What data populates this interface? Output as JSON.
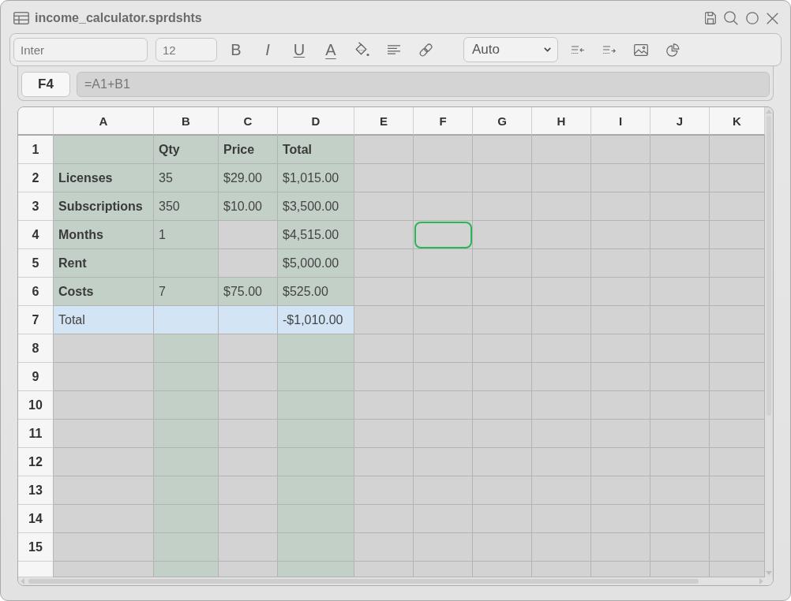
{
  "window": {
    "title": "income_calculator.sprdshts"
  },
  "toolbar": {
    "font": "Inter",
    "font_size": "12",
    "format_buttons": [
      {
        "kind": "bold",
        "label": "B"
      },
      {
        "kind": "italic",
        "label": "I"
      },
      {
        "kind": "underline",
        "label": "U"
      },
      {
        "kind": "text_color",
        "label": "A"
      }
    ],
    "number_format": "Auto"
  },
  "formula_bar": {
    "cell_reference": "F4",
    "formula": "=A1+B1"
  },
  "sheet": {
    "columns": [
      "A",
      "B",
      "C",
      "D",
      "E",
      "F",
      "G",
      "H",
      "I",
      "J",
      "K"
    ],
    "rows": [
      {
        "number": "1",
        "cells": [
          {
            "shaded": true,
            "highlighted": false,
            "selected": false
          },
          {
            "value": "Qty",
            "bold": true,
            "shaded": true,
            "highlighted": false,
            "selected": false
          },
          {
            "value": "Price",
            "bold": true,
            "shaded": true,
            "highlighted": false,
            "selected": false
          },
          {
            "value": "Total",
            "bold": true,
            "shaded": true,
            "highlighted": false,
            "selected": false
          },
          {
            "shaded": false,
            "highlighted": false,
            "selected": false
          },
          {
            "shaded": false,
            "highlighted": false,
            "selected": false
          },
          {
            "shaded": false,
            "highlighted": false,
            "selected": false
          },
          {
            "shaded": false,
            "highlighted": false,
            "selected": false
          },
          {
            "shaded": false,
            "highlighted": false,
            "selected": false
          },
          {
            "shaded": false,
            "highlighted": false,
            "selected": false
          },
          {
            "shaded": false,
            "highlighted": false,
            "selected": false
          }
        ]
      },
      {
        "number": "2",
        "cells": [
          {
            "value": "Licenses",
            "bold": true,
            "shaded": true,
            "highlighted": false,
            "selected": false
          },
          {
            "value": "35",
            "bold": false,
            "shaded": true,
            "highlighted": false,
            "selected": false
          },
          {
            "value": "$29.00",
            "bold": false,
            "shaded": true,
            "highlighted": false,
            "selected": false
          },
          {
            "value": "$1,015.00",
            "bold": false,
            "shaded": true,
            "highlighted": false,
            "selected": false
          },
          {
            "shaded": false,
            "highlighted": false,
            "selected": false
          },
          {
            "shaded": false,
            "highlighted": false,
            "selected": false
          },
          {
            "shaded": false,
            "highlighted": false,
            "selected": false
          },
          {
            "shaded": false,
            "highlighted": false,
            "selected": false
          },
          {
            "shaded": false,
            "highlighted": false,
            "selected": false
          },
          {
            "shaded": false,
            "highlighted": false,
            "selected": false
          },
          {
            "shaded": false,
            "highlighted": false,
            "selected": false
          }
        ]
      },
      {
        "number": "3",
        "cells": [
          {
            "value": "Subscriptions",
            "bold": true,
            "shaded": true,
            "highlighted": false,
            "selected": false
          },
          {
            "value": "350",
            "bold": false,
            "shaded": true,
            "highlighted": false,
            "selected": false
          },
          {
            "value": "$10.00",
            "bold": false,
            "shaded": true,
            "highlighted": false,
            "selected": false
          },
          {
            "value": "$3,500.00",
            "bold": false,
            "shaded": true,
            "highlighted": false,
            "selected": false
          },
          {
            "shaded": false,
            "highlighted": false,
            "selected": false
          },
          {
            "shaded": false,
            "highlighted": false,
            "selected": false
          },
          {
            "shaded": false,
            "highlighted": false,
            "selected": false
          },
          {
            "shaded": false,
            "highlighted": false,
            "selected": false
          },
          {
            "shaded": false,
            "highlighted": false,
            "selected": false
          },
          {
            "shaded": false,
            "highlighted": false,
            "selected": false
          },
          {
            "shaded": false,
            "highlighted": false,
            "selected": false
          }
        ]
      },
      {
        "number": "4",
        "cells": [
          {
            "value": "Months",
            "bold": true,
            "shaded": true,
            "highlighted": false,
            "selected": false
          },
          {
            "value": "1",
            "bold": false,
            "shaded": true,
            "highlighted": false,
            "selected": false
          },
          {
            "shaded": false,
            "highlighted": false,
            "selected": false
          },
          {
            "value": "$4,515.00",
            "bold": false,
            "shaded": true,
            "highlighted": false,
            "selected": false
          },
          {
            "shaded": false,
            "highlighted": false,
            "selected": false
          },
          {
            "shaded": false,
            "highlighted": false,
            "selected": true
          },
          {
            "shaded": false,
            "highlighted": false,
            "selected": false
          },
          {
            "shaded": false,
            "highlighted": false,
            "selected": false
          },
          {
            "shaded": false,
            "highlighted": false,
            "selected": false
          },
          {
            "shaded": false,
            "highlighted": false,
            "selected": false
          },
          {
            "shaded": false,
            "highlighted": false,
            "selected": false
          }
        ]
      },
      {
        "number": "5",
        "cells": [
          {
            "value": "Rent",
            "bold": true,
            "shaded": true,
            "highlighted": false,
            "selected": false
          },
          {
            "shaded": true,
            "highlighted": false,
            "selected": false
          },
          {
            "shaded": false,
            "highlighted": false,
            "selected": false
          },
          {
            "value": "$5,000.00",
            "bold": false,
            "shaded": true,
            "highlighted": false,
            "selected": false
          },
          {
            "shaded": false,
            "highlighted": false,
            "selected": false
          },
          {
            "shaded": false,
            "highlighted": false,
            "selected": false
          },
          {
            "shaded": false,
            "highlighted": false,
            "selected": false
          },
          {
            "shaded": false,
            "highlighted": false,
            "selected": false
          },
          {
            "shaded": false,
            "highlighted": false,
            "selected": false
          },
          {
            "shaded": false,
            "highlighted": false,
            "selected": false
          },
          {
            "shaded": false,
            "highlighted": false,
            "selected": false
          }
        ]
      },
      {
        "number": "6",
        "cells": [
          {
            "value": "Costs",
            "bold": true,
            "shaded": true,
            "highlighted": false,
            "selected": false
          },
          {
            "value": "7",
            "bold": false,
            "shaded": true,
            "highlighted": false,
            "selected": false
          },
          {
            "value": "$75.00",
            "bold": false,
            "shaded": true,
            "highlighted": false,
            "selected": false
          },
          {
            "value": "$525.00",
            "bold": false,
            "shaded": true,
            "highlighted": false,
            "selected": false
          },
          {
            "shaded": false,
            "highlighted": false,
            "selected": false
          },
          {
            "shaded": false,
            "highlighted": false,
            "selected": false
          },
          {
            "shaded": false,
            "highlighted": false,
            "selected": false
          },
          {
            "shaded": false,
            "highlighted": false,
            "selected": false
          },
          {
            "shaded": false,
            "highlighted": false,
            "selected": false
          },
          {
            "shaded": false,
            "highlighted": false,
            "selected": false
          },
          {
            "shaded": false,
            "highlighted": false,
            "selected": false
          }
        ]
      },
      {
        "number": "7",
        "cells": [
          {
            "value": "Total",
            "bold": false,
            "shaded": false,
            "highlighted": true,
            "selected": false
          },
          {
            "shaded": false,
            "highlighted": true,
            "selected": false
          },
          {
            "shaded": false,
            "highlighted": true,
            "selected": false
          },
          {
            "value": "-$1,010.00",
            "bold": false,
            "shaded": false,
            "highlighted": true,
            "selected": false
          },
          {
            "shaded": false,
            "highlighted": false,
            "selected": false
          },
          {
            "shaded": false,
            "highlighted": false,
            "selected": false
          },
          {
            "shaded": false,
            "highlighted": false,
            "selected": false
          },
          {
            "shaded": false,
            "highlighted": false,
            "selected": false
          },
          {
            "shaded": false,
            "highlighted": false,
            "selected": false
          },
          {
            "shaded": false,
            "highlighted": false,
            "selected": false
          },
          {
            "shaded": false,
            "highlighted": false,
            "selected": false
          }
        ]
      },
      {
        "number": "8",
        "cells": [
          {
            "shaded": false,
            "highlighted": false,
            "selected": false
          },
          {
            "shaded": true,
            "highlighted": false,
            "selected": false
          },
          {
            "shaded": false,
            "highlighted": false,
            "selected": false
          },
          {
            "shaded": true,
            "highlighted": false,
            "selected": false
          },
          {
            "shaded": false,
            "highlighted": false,
            "selected": false
          },
          {
            "shaded": false,
            "highlighted": false,
            "selected": false
          },
          {
            "shaded": false,
            "highlighted": false,
            "selected": false
          },
          {
            "shaded": false,
            "highlighted": false,
            "selected": false
          },
          {
            "shaded": false,
            "highlighted": false,
            "selected": false
          },
          {
            "shaded": false,
            "highlighted": false,
            "selected": false
          },
          {
            "shaded": false,
            "highlighted": false,
            "selected": false
          }
        ]
      },
      {
        "number": "9",
        "cells": [
          {
            "shaded": false,
            "highlighted": false,
            "selected": false
          },
          {
            "shaded": true,
            "highlighted": false,
            "selected": false
          },
          {
            "shaded": false,
            "highlighted": false,
            "selected": false
          },
          {
            "shaded": true,
            "highlighted": false,
            "selected": false
          },
          {
            "shaded": false,
            "highlighted": false,
            "selected": false
          },
          {
            "shaded": false,
            "highlighted": false,
            "selected": false
          },
          {
            "shaded": false,
            "highlighted": false,
            "selected": false
          },
          {
            "shaded": false,
            "highlighted": false,
            "selected": false
          },
          {
            "shaded": false,
            "highlighted": false,
            "selected": false
          },
          {
            "shaded": false,
            "highlighted": false,
            "selected": false
          },
          {
            "shaded": false,
            "highlighted": false,
            "selected": false
          }
        ]
      },
      {
        "number": "10",
        "cells": [
          {
            "shaded": false,
            "highlighted": false,
            "selected": false
          },
          {
            "shaded": true,
            "highlighted": false,
            "selected": false
          },
          {
            "shaded": false,
            "highlighted": false,
            "selected": false
          },
          {
            "shaded": true,
            "highlighted": false,
            "selected": false
          },
          {
            "shaded": false,
            "highlighted": false,
            "selected": false
          },
          {
            "shaded": false,
            "highlighted": false,
            "selected": false
          },
          {
            "shaded": false,
            "highlighted": false,
            "selected": false
          },
          {
            "shaded": false,
            "highlighted": false,
            "selected": false
          },
          {
            "shaded": false,
            "highlighted": false,
            "selected": false
          },
          {
            "shaded": false,
            "highlighted": false,
            "selected": false
          },
          {
            "shaded": false,
            "highlighted": false,
            "selected": false
          }
        ]
      },
      {
        "number": "11",
        "cells": [
          {
            "shaded": false,
            "highlighted": false,
            "selected": false
          },
          {
            "shaded": true,
            "highlighted": false,
            "selected": false
          },
          {
            "shaded": false,
            "highlighted": false,
            "selected": false
          },
          {
            "shaded": true,
            "highlighted": false,
            "selected": false
          },
          {
            "shaded": false,
            "highlighted": false,
            "selected": false
          },
          {
            "shaded": false,
            "highlighted": false,
            "selected": false
          },
          {
            "shaded": false,
            "highlighted": false,
            "selected": false
          },
          {
            "shaded": false,
            "highlighted": false,
            "selected": false
          },
          {
            "shaded": false,
            "highlighted": false,
            "selected": false
          },
          {
            "shaded": false,
            "highlighted": false,
            "selected": false
          },
          {
            "shaded": false,
            "highlighted": false,
            "selected": false
          }
        ]
      },
      {
        "number": "12",
        "cells": [
          {
            "shaded": false,
            "highlighted": false,
            "selected": false
          },
          {
            "shaded": true,
            "highlighted": false,
            "selected": false
          },
          {
            "shaded": false,
            "highlighted": false,
            "selected": false
          },
          {
            "shaded": true,
            "highlighted": false,
            "selected": false
          },
          {
            "shaded": false,
            "highlighted": false,
            "selected": false
          },
          {
            "shaded": false,
            "highlighted": false,
            "selected": false
          },
          {
            "shaded": false,
            "highlighted": false,
            "selected": false
          },
          {
            "shaded": false,
            "highlighted": false,
            "selected": false
          },
          {
            "shaded": false,
            "highlighted": false,
            "selected": false
          },
          {
            "shaded": false,
            "highlighted": false,
            "selected": false
          },
          {
            "shaded": false,
            "highlighted": false,
            "selected": false
          }
        ]
      },
      {
        "number": "13",
        "cells": [
          {
            "shaded": false,
            "highlighted": false,
            "selected": false
          },
          {
            "shaded": true,
            "highlighted": false,
            "selected": false
          },
          {
            "shaded": false,
            "highlighted": false,
            "selected": false
          },
          {
            "shaded": true,
            "highlighted": false,
            "selected": false
          },
          {
            "shaded": false,
            "highlighted": false,
            "selected": false
          },
          {
            "shaded": false,
            "highlighted": false,
            "selected": false
          },
          {
            "shaded": false,
            "highlighted": false,
            "selected": false
          },
          {
            "shaded": false,
            "highlighted": false,
            "selected": false
          },
          {
            "shaded": false,
            "highlighted": false,
            "selected": false
          },
          {
            "shaded": false,
            "highlighted": false,
            "selected": false
          },
          {
            "shaded": false,
            "highlighted": false,
            "selected": false
          }
        ]
      },
      {
        "number": "14",
        "cells": [
          {
            "shaded": false,
            "highlighted": false,
            "selected": false
          },
          {
            "shaded": true,
            "highlighted": false,
            "selected": false
          },
          {
            "shaded": false,
            "highlighted": false,
            "selected": false
          },
          {
            "shaded": true,
            "highlighted": false,
            "selected": false
          },
          {
            "shaded": false,
            "highlighted": false,
            "selected": false
          },
          {
            "shaded": false,
            "highlighted": false,
            "selected": false
          },
          {
            "shaded": false,
            "highlighted": false,
            "selected": false
          },
          {
            "shaded": false,
            "highlighted": false,
            "selected": false
          },
          {
            "shaded": false,
            "highlighted": false,
            "selected": false
          },
          {
            "shaded": false,
            "highlighted": false,
            "selected": false
          },
          {
            "shaded": false,
            "highlighted": false,
            "selected": false
          }
        ]
      },
      {
        "number": "15",
        "cells": [
          {
            "shaded": false,
            "highlighted": false,
            "selected": false
          },
          {
            "shaded": true,
            "highlighted": false,
            "selected": false
          },
          {
            "shaded": false,
            "highlighted": false,
            "selected": false
          },
          {
            "shaded": true,
            "highlighted": false,
            "selected": false
          },
          {
            "shaded": false,
            "highlighted": false,
            "selected": false
          },
          {
            "shaded": false,
            "highlighted": false,
            "selected": false
          },
          {
            "shaded": false,
            "highlighted": false,
            "selected": false
          },
          {
            "shaded": false,
            "highlighted": false,
            "selected": false
          },
          {
            "shaded": false,
            "highlighted": false,
            "selected": false
          },
          {
            "shaded": false,
            "highlighted": false,
            "selected": false
          },
          {
            "shaded": false,
            "highlighted": false,
            "selected": false
          }
        ]
      },
      {
        "cells": [
          {
            "shaded": false,
            "highlighted": false,
            "selected": false
          },
          {
            "shaded": true,
            "highlighted": false,
            "selected": false
          },
          {
            "shaded": false,
            "highlighted": false,
            "selected": false
          },
          {
            "shaded": true,
            "highlighted": false,
            "selected": false
          },
          {
            "shaded": false,
            "highlighted": false,
            "selected": false
          },
          {
            "shaded": false,
            "highlighted": false,
            "selected": false
          },
          {
            "shaded": false,
            "highlighted": false,
            "selected": false
          },
          {
            "shaded": false,
            "highlighted": false,
            "selected": false
          },
          {
            "shaded": false,
            "highlighted": false,
            "selected": false
          },
          {
            "shaded": false,
            "highlighted": false,
            "selected": false
          },
          {
            "shaded": false,
            "highlighted": false,
            "selected": false
          }
        ]
      }
    ]
  }
}
